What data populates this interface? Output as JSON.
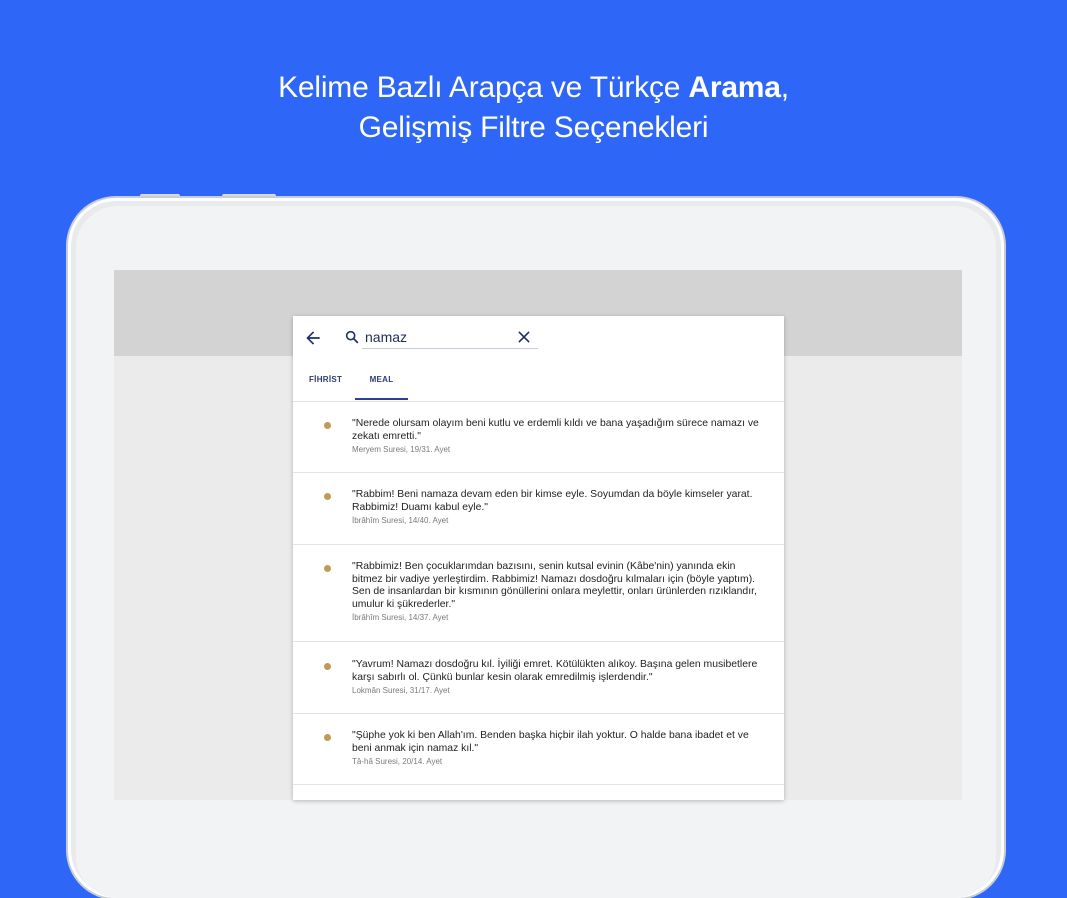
{
  "headline": {
    "line1_prefix": "Kelime Bazlı Arapça ve Türkçe ",
    "line1_bold": "Arama",
    "line1_suffix": ",",
    "line2": "Gelişmiş Filtre Seçenekleri"
  },
  "search": {
    "value": "namaz",
    "placeholder": ""
  },
  "icons": {
    "back": "arrow-left-icon",
    "search": "search-icon",
    "clear": "close-icon"
  },
  "tabs": [
    {
      "label": "FİHRİST",
      "active": false
    },
    {
      "label": "MEAL",
      "active": true
    }
  ],
  "results": [
    {
      "text": "\"Nerede olursam olayım beni kutlu ve erdemli kıldı ve bana yaşadığım sürece namazı ve\nzekatı emretti.\"",
      "ref": "Meryem Suresi, 19/31. Ayet"
    },
    {
      "text": "\"Rabbim! Beni namaza devam eden bir kimse eyle. Soyumdan da böyle kimseler yarat.\nRabbimiz! Duamı kabul eyle.\"",
      "ref": "İbrâhîm Suresi, 14/40. Ayet"
    },
    {
      "text": "\"Rabbimiz! Ben çocuklarımdan bazısını, senin kutsal evinin (Kâbe'nin) yanında ekin\nbitmez bir vadiye yerleştirdim. Rabbimiz! Namazı dosdoğru kılmaları için (böyle yaptım).\nSen de insanlardan bir kısmının gönüllerini onlara meylettir, onları ürünlerden rızıklandır,\numulur ki şükrederler.\"",
      "ref": "İbrâhîm Suresi, 14/37. Ayet"
    },
    {
      "text": "\"Yavrum! Namazı dosdoğru kıl. İyiliği emret. Kötülükten alıkoy. Başına gelen musibetlere\nkarşı sabırlı ol. Çünkü bunlar kesin olarak emredilmiş işlerdendir.\"",
      "ref": "Lokmân Suresi, 31/17. Ayet"
    },
    {
      "text": "\"Şüphe yok ki ben Allah'ım. Benden başka hiçbir ilah yoktur. O halde bana ibadet et ve\nbeni anmak için namaz kıl.\"",
      "ref": "Tâ-hâ Suresi, 20/14. Ayet"
    }
  ],
  "colors": {
    "background": "#2e67f8",
    "accent": "#2f3f95",
    "bullet": "#c09a55"
  }
}
